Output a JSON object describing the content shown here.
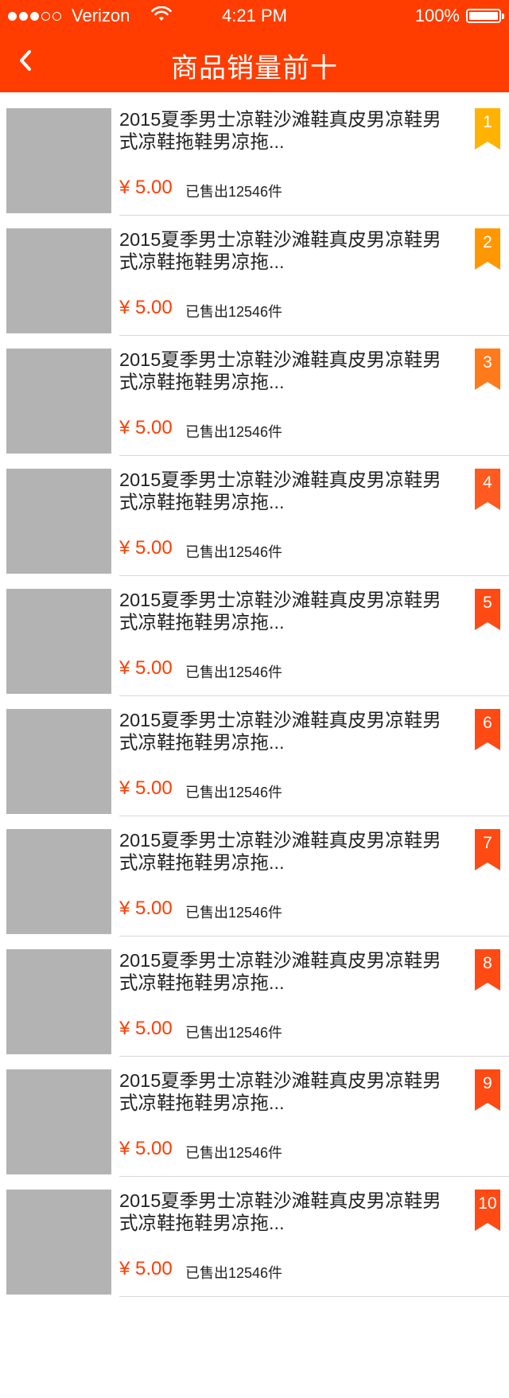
{
  "status_bar": {
    "carrier": "Verizon",
    "time": "4:21 PM",
    "battery": "100%",
    "signal_bars_filled": 3,
    "signal_bars_total": 5
  },
  "header": {
    "title": "商品销量前十",
    "back_icon": "chevron-left-icon"
  },
  "colors": {
    "accent": "#ff3d00",
    "thumbnail_placeholder": "#b3b3b3"
  },
  "products": [
    {
      "rank": "1",
      "badge_color": "#ffb300",
      "title": "2015夏季男士凉鞋沙滩鞋真皮男凉鞋男式凉鞋拖鞋男凉拖...",
      "price": "¥ 5.00",
      "sold": "已售出12546件"
    },
    {
      "rank": "2",
      "badge_color": "#ff9800",
      "title": "2015夏季男士凉鞋沙滩鞋真皮男凉鞋男式凉鞋拖鞋男凉拖...",
      "price": "¥ 5.00",
      "sold": "已售出12546件"
    },
    {
      "rank": "3",
      "badge_color": "#ff7a1a",
      "title": "2015夏季男士凉鞋沙滩鞋真皮男凉鞋男式凉鞋拖鞋男凉拖...",
      "price": "¥ 5.00",
      "sold": "已售出12546件"
    },
    {
      "rank": "4",
      "badge_color": "#ff5a1f",
      "title": "2015夏季男士凉鞋沙滩鞋真皮男凉鞋男式凉鞋拖鞋男凉拖...",
      "price": "¥ 5.00",
      "sold": "已售出12546件"
    },
    {
      "rank": "5",
      "badge_color": "#ff4a14",
      "title": "2015夏季男士凉鞋沙滩鞋真皮男凉鞋男式凉鞋拖鞋男凉拖...",
      "price": "¥ 5.00",
      "sold": "已售出12546件"
    },
    {
      "rank": "6",
      "badge_color": "#ff4a14",
      "title": "2015夏季男士凉鞋沙滩鞋真皮男凉鞋男式凉鞋拖鞋男凉拖...",
      "price": "¥ 5.00",
      "sold": "已售出12546件"
    },
    {
      "rank": "7",
      "badge_color": "#ff4a14",
      "title": "2015夏季男士凉鞋沙滩鞋真皮男凉鞋男式凉鞋拖鞋男凉拖...",
      "price": "¥ 5.00",
      "sold": "已售出12546件"
    },
    {
      "rank": "8",
      "badge_color": "#ff4a14",
      "title": "2015夏季男士凉鞋沙滩鞋真皮男凉鞋男式凉鞋拖鞋男凉拖...",
      "price": "¥ 5.00",
      "sold": "已售出12546件"
    },
    {
      "rank": "9",
      "badge_color": "#ff4a14",
      "title": "2015夏季男士凉鞋沙滩鞋真皮男凉鞋男式凉鞋拖鞋男凉拖...",
      "price": "¥ 5.00",
      "sold": "已售出12546件"
    },
    {
      "rank": "10",
      "badge_color": "#ff4a14",
      "title": "2015夏季男士凉鞋沙滩鞋真皮男凉鞋男式凉鞋拖鞋男凉拖...",
      "price": "¥ 5.00",
      "sold": "已售出12546件"
    }
  ]
}
